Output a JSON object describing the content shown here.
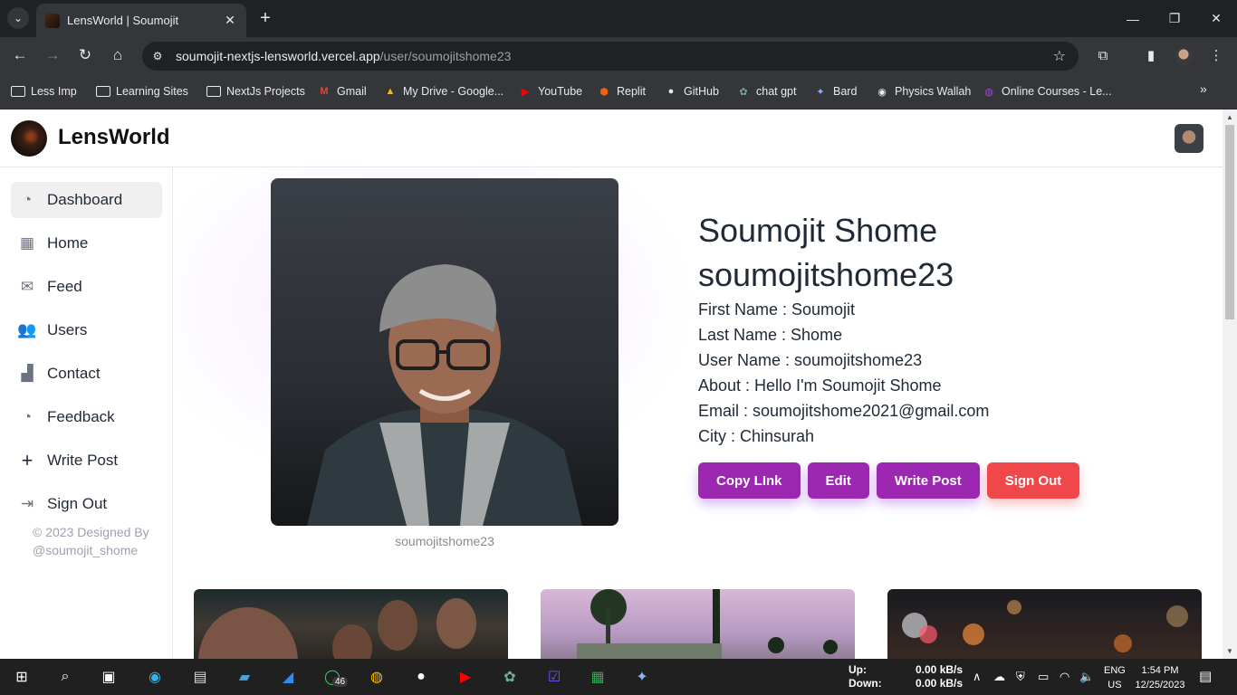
{
  "browser": {
    "tab_title": "LensWorld | Soumojit",
    "url_host": "soumojit-nextjs-lensworld.vercel.app",
    "url_path": "/user/soumojitshome23",
    "bookmarks": [
      "Less Imp",
      "Learning Sites",
      "NextJs Projects",
      "Gmail",
      "My Drive - Google...",
      "YouTube",
      "Replit",
      "GitHub",
      "chat gpt",
      "Bard",
      "Physics Wallah",
      "Online Courses - Le..."
    ]
  },
  "app": {
    "logo_text": "LensWorld"
  },
  "sidebar": {
    "items": [
      {
        "label": "Dashboard",
        "icon": "pie-chart-icon"
      },
      {
        "label": "Home",
        "icon": "grid-icon"
      },
      {
        "label": "Feed",
        "icon": "mailbox-icon"
      },
      {
        "label": "Users",
        "icon": "users-icon"
      },
      {
        "label": "Contact",
        "icon": "bag-icon"
      },
      {
        "label": "Feedback",
        "icon": "pie-chart-icon"
      },
      {
        "label": "Write Post",
        "icon": "plus-icon"
      },
      {
        "label": "Sign Out",
        "icon": "sign-out-icon"
      }
    ],
    "footer": "© 2023 Designed By @soumojit_shome"
  },
  "profile": {
    "full_name": "Soumojit Shome",
    "username": "soumojitshome23",
    "photo_caption": "soumojitshome23",
    "fields": [
      "First Name : Soumojit",
      "Last Name : Shome",
      "User Name : soumojitshome23",
      "About : Hello I'm Soumojit Shome",
      "Email : soumojitshome2021@gmail.com",
      "City : Chinsurah"
    ],
    "buttons": {
      "copy_link": "Copy LInk",
      "edit": "Edit",
      "write_post": "Write Post",
      "sign_out": "Sign Out"
    },
    "colors": {
      "accent": "#9c27b0",
      "danger": "#f0474a"
    }
  },
  "taskbar": {
    "net_up_label": "Up:",
    "net_down_label": "Down:",
    "net_up": "0.00 kB/s",
    "net_down": "0.00 kB/s",
    "whatsapp_badge": "46",
    "lang_1": "ENG",
    "lang_2": "US",
    "time": "1:54 PM",
    "date": "12/25/2023"
  }
}
